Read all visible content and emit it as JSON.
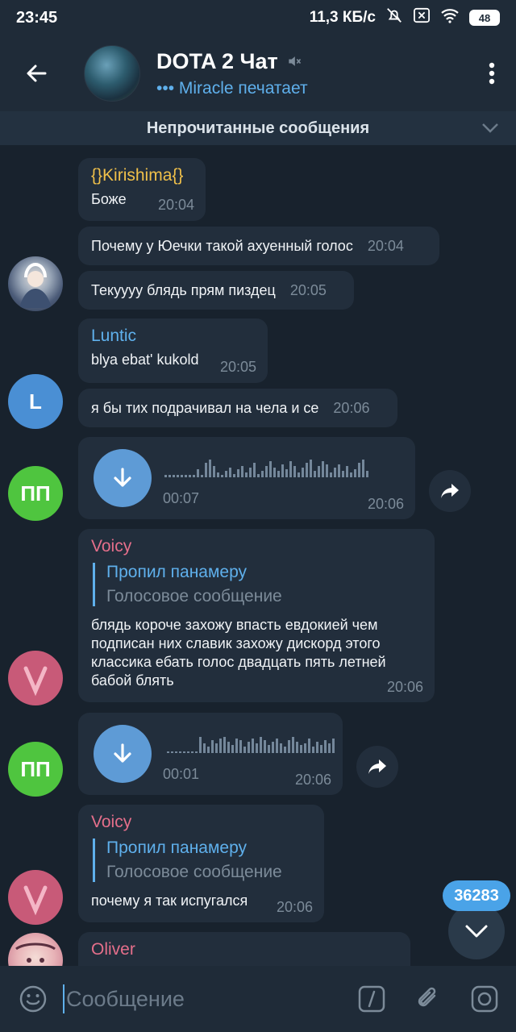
{
  "status_bar": {
    "time": "23:45",
    "network_speed": "11,3 КБ/с",
    "battery": "48"
  },
  "header": {
    "title": "DOTA 2 Чат",
    "typing_status": "••• Miracle печатает"
  },
  "unread_banner": "Непрочитанные сообщения",
  "messages": [
    {
      "sender": "{}Kirishima{}",
      "text": "Боже",
      "time": "20:04"
    },
    {
      "text": "Почему у Юечки такой ахуенный голос",
      "time": "20:04"
    },
    {
      "text": "Текуууу блядь прям пиздец",
      "time": "20:05"
    },
    {
      "sender": "Luntic",
      "text": "blya ebat' kukold",
      "time": "20:05",
      "avatar_letter": "L"
    },
    {
      "text": "я бы тих подрачивал на чела и се",
      "time": "20:06"
    },
    {
      "voice_duration": "00:07",
      "time": "20:06",
      "avatar_initials": "ПП"
    },
    {
      "sender": "Voicy",
      "reply_name": "Пропил панамеру",
      "reply_text": "Голосовое сообщение",
      "text": "блядь короче захожу впасть евдокией чем подписан них славик захожу дискорд этого классика ебать голос двадцать пять летней бабой блять",
      "time": "20:06",
      "avatar_letter": "V"
    },
    {
      "voice_duration": "00:01",
      "time": "20:06",
      "avatar_initials": "ПП"
    },
    {
      "sender": "Voicy",
      "reply_name": "Пропил панамеру",
      "reply_text": "Голосовое сообщение",
      "text": "почему я так испугался",
      "time": "20:06",
      "avatar_letter": "V"
    },
    {
      "sender": "Oliver"
    }
  ],
  "unread_count": "36283",
  "input": {
    "placeholder": "Сообщение"
  },
  "colors": {
    "accent": "#5fb0ec",
    "bubble": "#222e3c",
    "background": "#18222d",
    "kirishima": "#f0c04a",
    "voicy": "#e56f8b",
    "pp_avatar": "#4fc53f",
    "voice_button": "#5e9bd6"
  }
}
